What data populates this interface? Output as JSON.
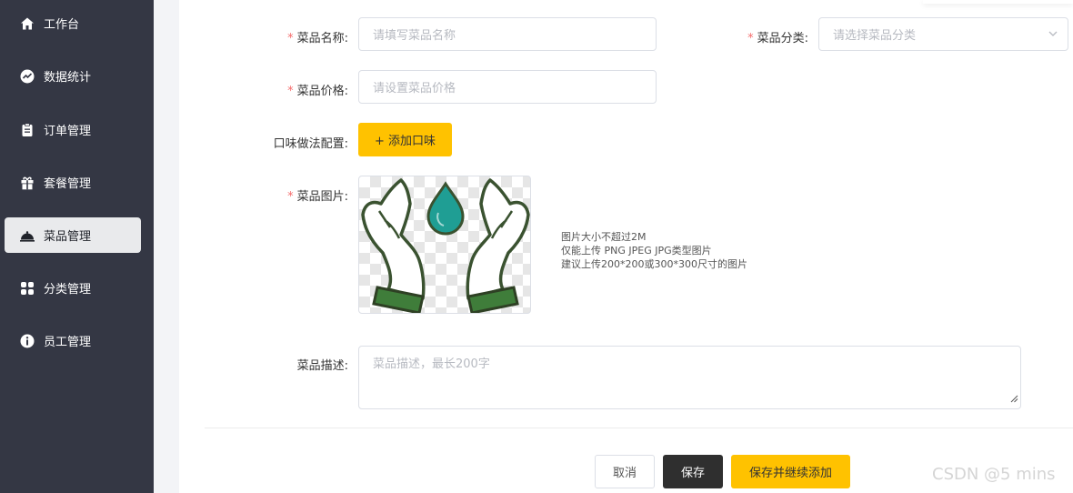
{
  "sidebar": {
    "items": [
      {
        "label": "工作台",
        "icon": "home-icon"
      },
      {
        "label": "数据统计",
        "icon": "chart-icon"
      },
      {
        "label": "订单管理",
        "icon": "clipboard-icon"
      },
      {
        "label": "套餐管理",
        "icon": "gift-icon"
      },
      {
        "label": "菜品管理",
        "icon": "cloche-icon",
        "active": true
      },
      {
        "label": "分类管理",
        "icon": "grid-icon"
      },
      {
        "label": "员工管理",
        "icon": "user-info-icon"
      }
    ]
  },
  "form": {
    "name": {
      "label": "菜品名称:",
      "placeholder": "请填写菜品名称",
      "required": true
    },
    "category": {
      "label": "菜品分类:",
      "placeholder": "请选择菜品分类",
      "required": true
    },
    "price": {
      "label": "菜品价格:",
      "placeholder": "请设置菜品价格",
      "required": true
    },
    "flavor": {
      "label": "口味做法配置:",
      "button": "+ 添加口味"
    },
    "image": {
      "label": "菜品图片:",
      "required": true,
      "tips": [
        "图片大小不超过2M",
        "仅能上传 PNG JPEG JPG类型图片",
        "建议上传200*200或300*300尺寸的图片"
      ]
    },
    "description": {
      "label": "菜品描述:",
      "placeholder": "菜品描述，最长200字"
    }
  },
  "actions": {
    "cancel": "取消",
    "save": "保存",
    "save_continue": "保存并继续添加"
  },
  "required_mark": "*",
  "watermark": "CSDN @5 mins",
  "colors": {
    "sidebar_bg": "#343744",
    "accent": "#ffc200",
    "dark_button": "#2f2f2f",
    "required": "#f56c6c"
  }
}
